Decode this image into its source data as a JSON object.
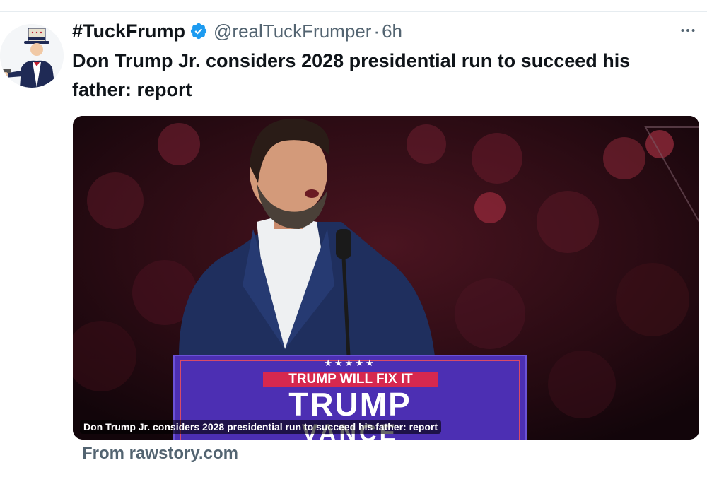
{
  "tweet": {
    "display_name": "#TuckFrump",
    "handle": "@realTuckFrumper",
    "separator": "·",
    "time": "6h",
    "text": "Don Trump Jr. considers 2028 presidential run to succeed his father: report",
    "verified": true,
    "accent_color": "#1d9bf0"
  },
  "card": {
    "caption": "Don Trump Jr. considers 2028 presidential run to succeed his father: report",
    "source": "From rawstory.com",
    "podium": {
      "stars": "★★★★★",
      "slogan": "TRUMP WILL FIX IT",
      "name": "TRUMP",
      "running_mate": "VANCE"
    }
  },
  "icons": {
    "verified": "verified-badge-icon",
    "more": "more-horizontal-icon",
    "avatar": "uncle-sam-avatar-icon"
  }
}
